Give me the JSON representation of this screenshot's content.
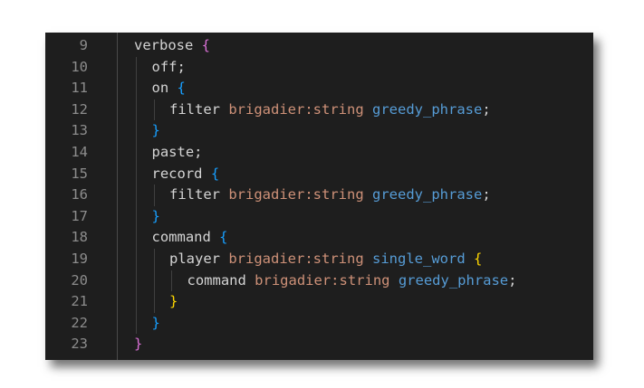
{
  "editor": {
    "lines": [
      {
        "number": "9",
        "indent": 0,
        "tokens": [
          {
            "text": "verbose",
            "cls": "kw"
          },
          {
            "text": " "
          },
          {
            "text": "{",
            "cls": "b1"
          }
        ]
      },
      {
        "number": "10",
        "indent": 1,
        "tokens": [
          {
            "text": "off;",
            "cls": "kw"
          }
        ]
      },
      {
        "number": "11",
        "indent": 1,
        "tokens": [
          {
            "text": "on",
            "cls": "kw"
          },
          {
            "text": " "
          },
          {
            "text": "{",
            "cls": "b2"
          }
        ]
      },
      {
        "number": "12",
        "indent": 2,
        "tokens": [
          {
            "text": "filter",
            "cls": "kw"
          },
          {
            "text": " "
          },
          {
            "text": "brigadier:string",
            "cls": "ty"
          },
          {
            "text": " "
          },
          {
            "text": "greedy_phrase",
            "cls": "pr"
          },
          {
            "text": ";",
            "cls": "kw"
          }
        ]
      },
      {
        "number": "13",
        "indent": 1,
        "tokens": [
          {
            "text": "}",
            "cls": "b2"
          }
        ]
      },
      {
        "number": "14",
        "indent": 1,
        "tokens": [
          {
            "text": "paste;",
            "cls": "kw"
          }
        ]
      },
      {
        "number": "15",
        "indent": 1,
        "tokens": [
          {
            "text": "record",
            "cls": "kw"
          },
          {
            "text": " "
          },
          {
            "text": "{",
            "cls": "b2"
          }
        ]
      },
      {
        "number": "16",
        "indent": 2,
        "tokens": [
          {
            "text": "filter",
            "cls": "kw"
          },
          {
            "text": " "
          },
          {
            "text": "brigadier:string",
            "cls": "ty"
          },
          {
            "text": " "
          },
          {
            "text": "greedy_phrase",
            "cls": "pr"
          },
          {
            "text": ";",
            "cls": "kw"
          }
        ]
      },
      {
        "number": "17",
        "indent": 1,
        "tokens": [
          {
            "text": "}",
            "cls": "b2"
          }
        ]
      },
      {
        "number": "18",
        "indent": 1,
        "tokens": [
          {
            "text": "command",
            "cls": "kw"
          },
          {
            "text": " "
          },
          {
            "text": "{",
            "cls": "b2"
          }
        ]
      },
      {
        "number": "19",
        "indent": 2,
        "tokens": [
          {
            "text": "player",
            "cls": "kw"
          },
          {
            "text": " "
          },
          {
            "text": "brigadier:string",
            "cls": "ty"
          },
          {
            "text": " "
          },
          {
            "text": "single_word",
            "cls": "pr"
          },
          {
            "text": " "
          },
          {
            "text": "{",
            "cls": "b3"
          }
        ]
      },
      {
        "number": "20",
        "indent": 3,
        "tokens": [
          {
            "text": "command",
            "cls": "kw"
          },
          {
            "text": " "
          },
          {
            "text": "brigadier:string",
            "cls": "ty"
          },
          {
            "text": " "
          },
          {
            "text": "greedy_phrase",
            "cls": "pr"
          },
          {
            "text": ";",
            "cls": "kw"
          }
        ]
      },
      {
        "number": "21",
        "indent": 2,
        "tokens": [
          {
            "text": "}",
            "cls": "b3"
          }
        ]
      },
      {
        "number": "22",
        "indent": 1,
        "tokens": [
          {
            "text": "}",
            "cls": "b2"
          }
        ]
      },
      {
        "number": "23",
        "indent": 0,
        "tokens": [
          {
            "text": "}",
            "cls": "b1"
          }
        ]
      }
    ]
  }
}
